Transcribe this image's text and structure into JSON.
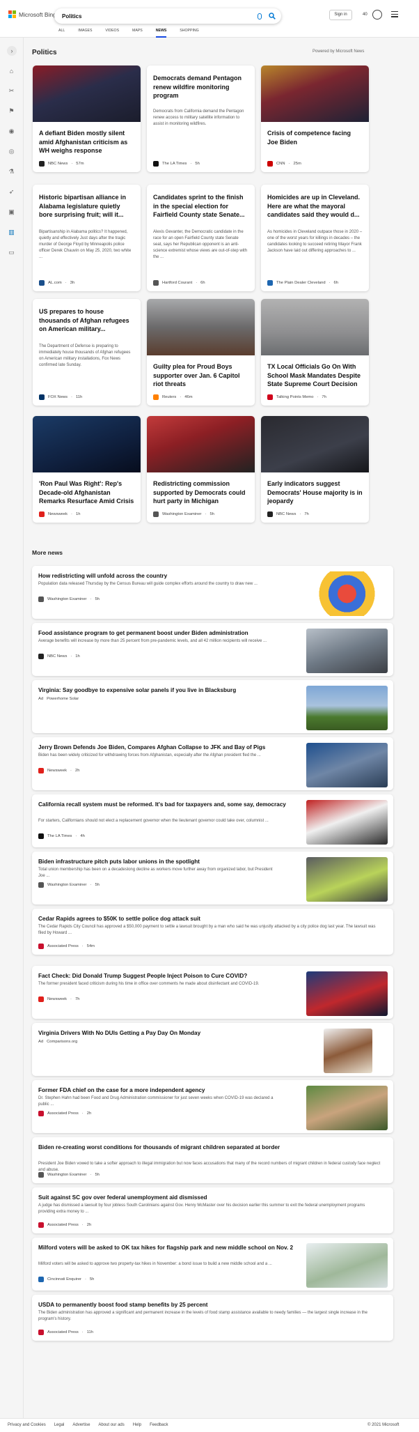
{
  "app": {
    "logo_text": "Microsoft Bing"
  },
  "search": {
    "query": "Politics"
  },
  "header": {
    "sign_in": "Sign in",
    "points": "40"
  },
  "tabs": [
    {
      "label": "ALL"
    },
    {
      "label": "IMAGES"
    },
    {
      "label": "VIDEOS"
    },
    {
      "label": "MAPS"
    },
    {
      "label": "NEWS",
      "active": true
    },
    {
      "label": "SHOPPING"
    }
  ],
  "sidebar": {
    "icons": [
      "chevron-right-icon",
      "home-icon",
      "tools-icon",
      "flag-icon",
      "location-icon",
      "globe-icon",
      "microscope-icon",
      "rocket-icon",
      "film-icon",
      "building-icon",
      "money-icon"
    ]
  },
  "section": {
    "title": "Politics",
    "powered_by": "Powered by Microsoft News"
  },
  "cards": [
    {
      "headline": "A defiant Biden mostly silent amid Afghanistan criticism as WH weighs response",
      "summary": "",
      "source": "NBC News",
      "time": "57m",
      "src_color": "#222"
    },
    {
      "headline": "Democrats demand Pentagon renew wildfire monitoring program",
      "summary": "Democrats from California demand the Pentagon renew access to military satellite information to assist in monitoring wildfires.",
      "source": "The LA Times",
      "time": "5h",
      "src_color": "#111"
    },
    {
      "headline": "Crisis of competence facing Joe Biden",
      "summary": "",
      "source": "CNN",
      "time": "25m",
      "src_color": "#cc0000"
    },
    {
      "headline": "Historic bipartisan alliance in Alabama legislature quietly bore surprising fruit; will it...",
      "summary": "Bipartisanship in Alabama politics? It happened, quietly and effectively Just days after the tragic murder of George Floyd by Minneapolis police officer Derek Chauvin on May 25, 2020, two white ...",
      "source": "AL.com",
      "time": "3h",
      "src_color": "#1a4f8b"
    },
    {
      "headline": "Candidates sprint to the finish in the special election for Fairfield County state Senate...",
      "summary": "Alexis Gevanter, the Democratic candidate in the race for an open Fairfield County state Senate seat, says her Republican opponent is an anti-science extremist whose views are out-of-step with the ...",
      "source": "Hartford Courant",
      "time": "6h",
      "src_color": "#555"
    },
    {
      "headline": "Homicides are up in Cleveland. Here are what the mayoral candidates said they would d...",
      "summary": "As homicides in Cleveland outpace those in 2020 – one of the worst years for killings in decades – the candidates looking to succeed retiring Mayor Frank Jackson have laid out differing approaches to ...",
      "source": "The Plain Dealer Cleveland",
      "time": "6h",
      "src_color": "#1d66b0"
    },
    {
      "headline": "US prepares to house thousands of Afghan refugees on American military...",
      "summary": "The Department of Defense is preparing to immediately house thousands of Afghan refugees on American military installations, Fox News confirmed late Sunday.",
      "source": "FOX News",
      "time": "11h",
      "src_color": "#003366"
    },
    {
      "headline": "Guilty plea for Proud Boys supporter over Jan. 6 Capitol riot threats",
      "summary": "",
      "source": "Reuters",
      "time": "46m",
      "src_color": "#ff8000"
    },
    {
      "headline": "TX Local Officials Go On With School Mask Mandates Despite State Supreme Court Decision",
      "summary": "",
      "source": "Talking Points Memo",
      "time": "7h",
      "src_color": "#d0021b"
    },
    {
      "headline": "'Ron Paul Was Right': Rep's Decade-old Afghanistan Remarks Resurface Amid Crisis",
      "summary": "",
      "source": "Newsweek",
      "time": "1h",
      "src_color": "#e0201b"
    },
    {
      "headline": "Redistricting commission supported by Democrats could hurt party in Michigan",
      "summary": "",
      "source": "Washington Examiner",
      "time": "5h",
      "src_color": "#555"
    },
    {
      "headline": "Early indicators suggest Democrats' House majority is in jeopardy",
      "summary": "",
      "source": "NBC News",
      "time": "7h",
      "src_color": "#222"
    }
  ],
  "more_news": {
    "title": "More news",
    "items": [
      {
        "headline": "How redistricting will unfold across the country",
        "summary": "Population data released Thursday by the Census Bureau will guide complex efforts around the country to draw new ...",
        "source": "Washington Examiner",
        "time": "5h",
        "src_color": "#555"
      },
      {
        "headline": "Food assistance program to get permanent boost under Biden administration",
        "summary": "Average benefits will increase by more than 25 percent from pre-pandemic levels, and all 42 million recipients will receive ...",
        "source": "NBC News",
        "time": "1h",
        "src_color": "#222"
      },
      {
        "headline": "Virginia: Say goodbye to expensive solar panels if you live in Blacksburg",
        "summary": "",
        "source": "Powerhome Solar",
        "time": "",
        "ad": "Ad",
        "src_color": "#fff"
      },
      {
        "headline": "Jerry Brown Defends Joe Biden, Compares Afghan Collapse to JFK and Bay of Pigs",
        "summary": "Biden has been widely criticized for withdrawing forces from Afghanistan, especially after the Afghan president fled the ...",
        "source": "Newsweek",
        "time": "2h",
        "src_color": "#e0201b"
      },
      {
        "headline": "California recall system must be reformed. It's bad for taxpayers and, some say, democracy",
        "summary": "For starters, Californians should not elect a replacement governor when the lieutenant governor could take over, columnist ...",
        "source": "The LA Times",
        "time": "4h",
        "src_color": "#111"
      },
      {
        "headline": "Biden infrastructure pitch puts labor unions in the spotlight",
        "summary": "Total union membership has been on a decadeslong decline as workers move further away from organized labor, but President Joe ...",
        "source": "Washington Examiner",
        "time": "5h",
        "src_color": "#555"
      },
      {
        "headline": "Cedar Rapids agrees to $50K to settle police dog attack suit",
        "summary": "The Cedar Rapids City Council has approved a $50,000 payment to settle a lawsuit brought by a man who said he was unjustly attacked by a city police dog last year. The lawsuit was filed by Howard ...",
        "source": "Associated Press",
        "time": "54m",
        "src_color": "#c8102e"
      },
      {
        "headline": "Fact Check: Did Donald Trump Suggest People Inject Poison to Cure COVID?",
        "summary": "The former president faced criticism during his time in office over comments he made about disinfectant and COVID-19.",
        "source": "Newsweek",
        "time": "7h",
        "src_color": "#e0201b"
      },
      {
        "headline": "Virginia Drivers With No DUIs Getting a Pay Day On Monday",
        "summary": "",
        "source": "Comparisons.org",
        "time": "",
        "ad": "Ad",
        "src_color": "#fff"
      },
      {
        "headline": "Former FDA chief on the case for a more independent agency",
        "summary": "Dr. Stephen Hahn had been Food and Drug Administration commissioner for just seven weeks when COVID-19 was declared a public ...",
        "source": "Associated Press",
        "time": "2h",
        "src_color": "#c8102e"
      },
      {
        "headline": "Biden re-creating worst conditions for thousands of migrant children separated at border",
        "summary": "President Joe Biden vowed to take a softer approach to illegal immigration but now faces accusations that many of the record numbers of migrant children in federal custody face neglect and abuse.",
        "source": "Washington Examiner",
        "time": "5h",
        "src_color": "#555"
      },
      {
        "headline": "Suit against SC gov over federal unemployment aid dismissed",
        "summary": "A judge has dismissed a lawsuit by four jobless South Carolinians against Gov. Henry McMaster over his decision earlier this summer to exit the federal unemployment programs providing extra money to ...",
        "source": "Associated Press",
        "time": "2h",
        "src_color": "#c8102e"
      },
      {
        "headline": "Milford voters will be asked to OK tax hikes for flagship park and new middle school on Nov. 2",
        "summary": "Milford voters will be asked to approve two property-tax hikes in November: a bond issue to build a new middle school and a ...",
        "source": "Cincinnati Enquirer",
        "time": "5h",
        "src_color": "#1d66b0"
      },
      {
        "headline": "USDA to permanently boost food stamp benefits by 25 percent",
        "summary": "The Biden administration has approved a significant and permanent increase in the levels of food stamp assistance available to needy families — the largest single increase in the program's history.",
        "source": "Associated Press",
        "time": "11h",
        "src_color": "#c8102e"
      }
    ]
  },
  "footer": {
    "links": [
      "Privacy and Cookies",
      "Legal",
      "Advertise",
      "About our ads",
      "Help",
      "Feedback"
    ],
    "copyright": "© 2021 Microsoft"
  }
}
